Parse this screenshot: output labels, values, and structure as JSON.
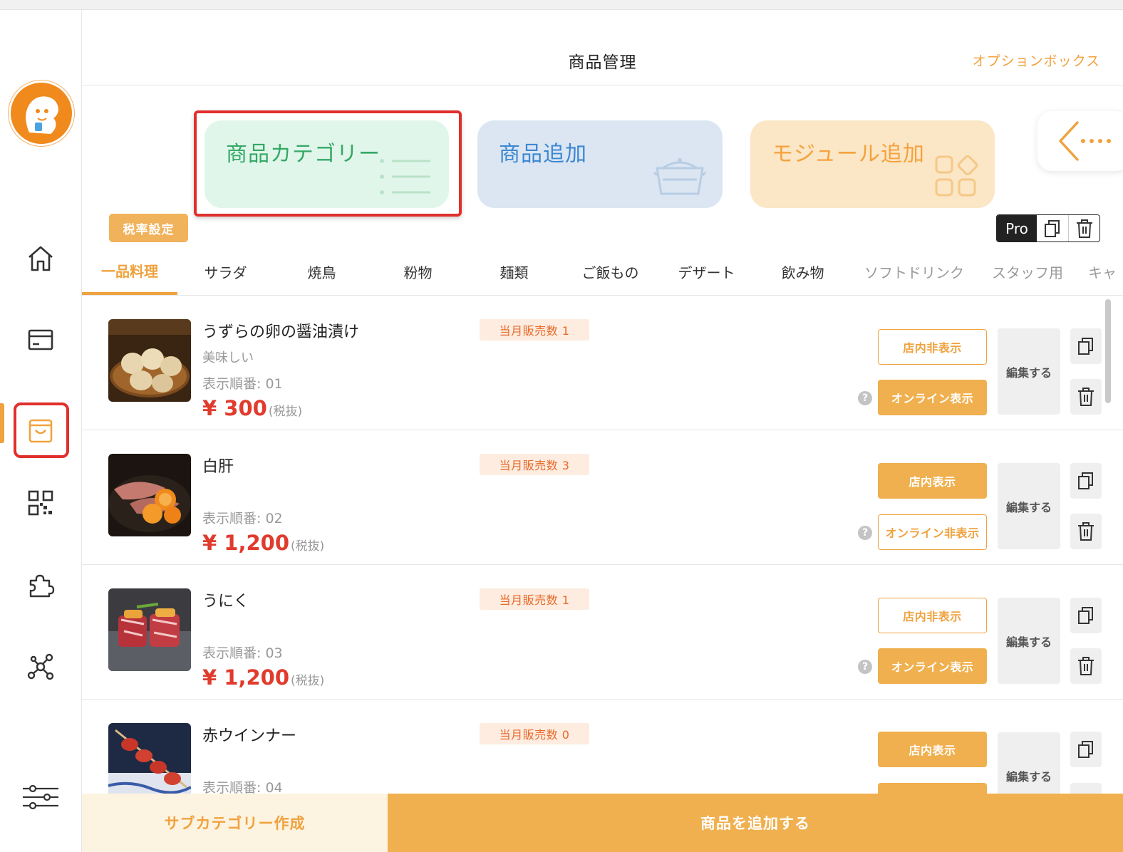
{
  "header": {
    "title": "商品管理",
    "option_box": "オプションボックス"
  },
  "sidebar": {
    "items": [
      {
        "icon": "home-icon"
      },
      {
        "icon": "payment-card-icon"
      },
      {
        "icon": "shopping-bag-icon",
        "active": true
      },
      {
        "icon": "qr-code-icon"
      },
      {
        "icon": "puzzle-icon"
      },
      {
        "icon": "network-icon"
      },
      {
        "icon": "settings-sliders-icon"
      }
    ]
  },
  "cards": {
    "category": "商品カテゴリー",
    "add_product": "商品追加",
    "add_module": "モジュール追加"
  },
  "tax_setting": "税率設定",
  "pro_badge": "Pro",
  "tabs": [
    "一品料理",
    "サラダ",
    "焼鳥",
    "粉物",
    "麺類",
    "ご飯もの",
    "デザート",
    "飲み物",
    "ソフトドリンク",
    "スタッフ用",
    "キャ"
  ],
  "products": [
    {
      "name": "うずらの卵の醤油漬け",
      "desc": "美味しい",
      "order": "表示順番: 01",
      "price": "¥ 300",
      "tax": "(税抜)",
      "sales": "当月販売数 1",
      "store_btn": "店内非表示",
      "online_btn": "オンライン表示",
      "edit": "編集する"
    },
    {
      "name": "白肝",
      "desc": "",
      "order": "表示順番: 02",
      "price": "¥ 1,200",
      "tax": "(税抜)",
      "sales": "当月販売数 3",
      "store_btn": "店内表示",
      "online_btn": "オンライン非表示",
      "edit": "編集する"
    },
    {
      "name": "うにく",
      "desc": "",
      "order": "表示順番: 03",
      "price": "¥ 1,200",
      "tax": "(税抜)",
      "sales": "当月販売数 1",
      "store_btn": "店内非表示",
      "online_btn": "オンライン表示",
      "edit": "編集する"
    },
    {
      "name": "赤ウインナー",
      "desc": "",
      "order": "表示順番: 04",
      "price": "",
      "tax": "",
      "sales": "当月販売数 0",
      "store_btn": "店内表示",
      "online_btn": "",
      "edit": "編集する"
    }
  ],
  "help_mark": "?",
  "bottom": {
    "subcategory": "サブカテゴリー作成",
    "add_product": "商品を追加する"
  },
  "colors": {
    "accent": "#f0a23e",
    "price": "#e03b2d",
    "highlight": "#e0302c",
    "category_card": "#e1f6ea",
    "add_card": "#dbe6f2",
    "module_card": "#fbe6c6"
  }
}
